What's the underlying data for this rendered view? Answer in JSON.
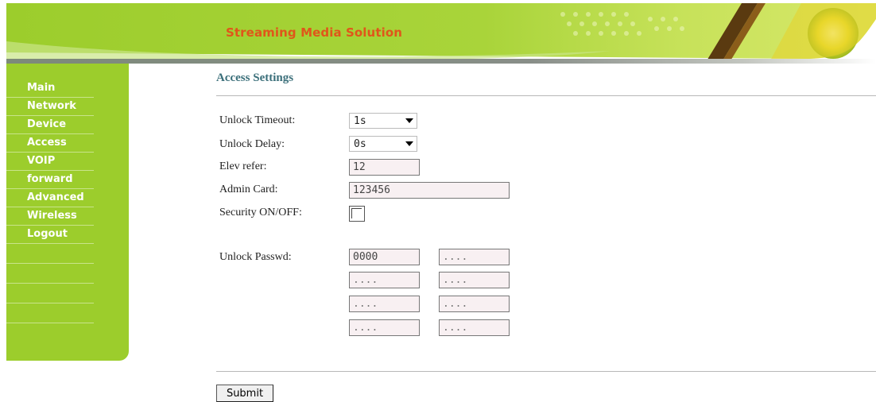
{
  "header": {
    "title": "Streaming Media Solution"
  },
  "sidebar": {
    "items": [
      {
        "label": "Main"
      },
      {
        "label": "Network"
      },
      {
        "label": "Device"
      },
      {
        "label": "Access"
      },
      {
        "label": "VOIP"
      },
      {
        "label": "forward"
      },
      {
        "label": "Advanced"
      },
      {
        "label": "Wireless"
      },
      {
        "label": "Logout"
      }
    ]
  },
  "main": {
    "title": "Access Settings",
    "unlock_timeout": {
      "label": "Unlock Timeout:",
      "value": "1s"
    },
    "unlock_delay": {
      "label": "Unlock Delay:",
      "value": "0s"
    },
    "elev_refer": {
      "label": "Elev refer:",
      "value": "12"
    },
    "admin_card": {
      "label": "Admin Card:",
      "value": "123456"
    },
    "security": {
      "label": "Security ON/OFF:",
      "checked": false
    },
    "unlock_passwd": {
      "label": "Unlock Passwd:",
      "fields": [
        {
          "value": "0000",
          "placeholder": ""
        },
        {
          "value": "",
          "placeholder": "...."
        },
        {
          "value": "",
          "placeholder": "...."
        },
        {
          "value": "",
          "placeholder": "...."
        },
        {
          "value": "",
          "placeholder": "...."
        },
        {
          "value": "",
          "placeholder": "...."
        },
        {
          "value": "",
          "placeholder": "...."
        },
        {
          "value": "",
          "placeholder": "...."
        }
      ]
    },
    "submit_label": "Submit"
  },
  "colors": {
    "brand_green": "#9ccd2c",
    "title_orange": "#e0561a",
    "heading_teal": "#3b6f7a"
  }
}
